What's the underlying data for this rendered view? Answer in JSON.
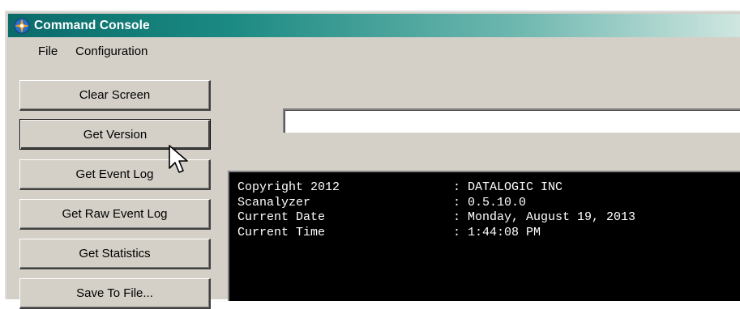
{
  "window": {
    "title": "Command Console",
    "icon": "app-compass-icon",
    "title_gradient": [
      "#0a6a6a",
      "#cfe6e0"
    ]
  },
  "menu": {
    "items": [
      {
        "label": "File"
      },
      {
        "label": "Configuration"
      }
    ]
  },
  "sidebar": {
    "buttons": [
      {
        "label": "Clear Screen"
      },
      {
        "label": "Get Version"
      },
      {
        "label": "Get Event Log"
      },
      {
        "label": "Get Raw Event Log"
      },
      {
        "label": "Get Statistics"
      },
      {
        "label": "Save To File..."
      }
    ]
  },
  "command_input": {
    "value": ""
  },
  "output": {
    "background": "#000000",
    "text_color": "#ffffff",
    "rows": [
      {
        "key": "Copyright 2012",
        "value": ": DATALOGIC INC"
      },
      {
        "key": "Scanalyzer",
        "value": ": 0.5.10.0"
      },
      {
        "key": "Current Date",
        "value": ": Monday, August 19, 2013"
      },
      {
        "key": "Current Time",
        "value": ": 1:44:08 PM"
      }
    ]
  },
  "pointer": {
    "icon": "mouse-pointer-icon"
  }
}
